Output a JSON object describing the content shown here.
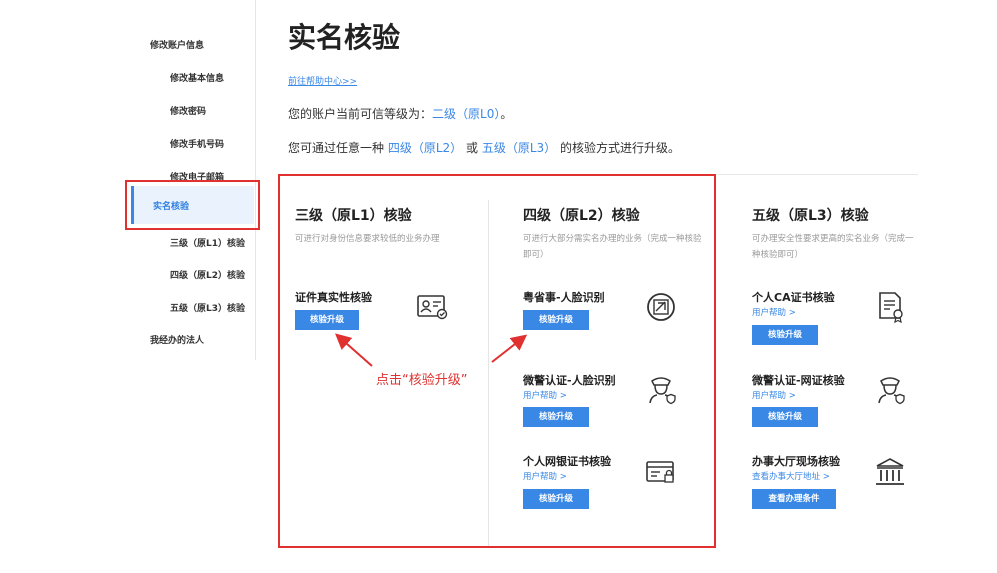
{
  "sidebar": {
    "items": [
      {
        "label": "修改账户信息"
      },
      {
        "label": "修改基本信息"
      },
      {
        "label": "修改密码"
      },
      {
        "label": "修改手机号码"
      },
      {
        "label": "修改电子邮箱"
      },
      {
        "label": "实名核验"
      },
      {
        "label": "三级（原L1）核验"
      },
      {
        "label": "四级（原L2）核验"
      },
      {
        "label": "五级（原L3）核验"
      },
      {
        "label": "我经办的法人"
      }
    ]
  },
  "main": {
    "title": "实名核验",
    "help_link": "前往帮助中心>>",
    "level_prefix": "您的账户当前可信等级为：",
    "level_value": "二级（原L0）",
    "level_suffix": "。",
    "upgrade_prefix": "您可通过任意一种",
    "upgrade_l2": "四级（原L2）",
    "upgrade_or": "或",
    "upgrade_l3": "五级（原L3）",
    "upgrade_suffix": "的核验方式进行升级。"
  },
  "columns": {
    "l1": {
      "title": "三级（原L1）核验",
      "desc": "可进行对身份信息要求较低的业务办理",
      "methods": [
        {
          "name": "证件真实性核验",
          "button": "核验升级",
          "icon": "id-card-icon"
        }
      ]
    },
    "l2": {
      "title": "四级（原L2）核验",
      "desc": "可进行大部分需实名办理的业务（完成一种核验即可）",
      "methods": [
        {
          "name": "粤省事-人脸识别",
          "button": "核验升级",
          "icon": "face-scan-icon"
        },
        {
          "name": "微警认证-人脸识别",
          "help": "用户帮助 >",
          "button": "核验升级",
          "icon": "police-icon"
        },
        {
          "name": "个人网银证书核验",
          "help": "用户帮助 >",
          "button": "核验升级",
          "icon": "bank-card-icon"
        }
      ]
    },
    "l3": {
      "title": "五级（原L3）核验",
      "desc": "可办理安全性要求更高的实名业务（完成一种核验即可）",
      "methods": [
        {
          "name": "个人CA证书核验",
          "help": "用户帮助 >",
          "button": "核验升级",
          "icon": "certificate-icon"
        },
        {
          "name": "微警认证-网证核验",
          "help": "用户帮助 >",
          "button": "核验升级",
          "icon": "police-icon"
        },
        {
          "name": "办事大厅现场核验",
          "help": "查看办事大厅地址 >",
          "button": "查看办理条件",
          "icon": "hall-icon"
        }
      ]
    }
  },
  "annotation": {
    "callout": "点击“核验升级”",
    "color": "#e03030"
  },
  "colors": {
    "accent": "#3a88e6",
    "highlight": "#e03030"
  }
}
